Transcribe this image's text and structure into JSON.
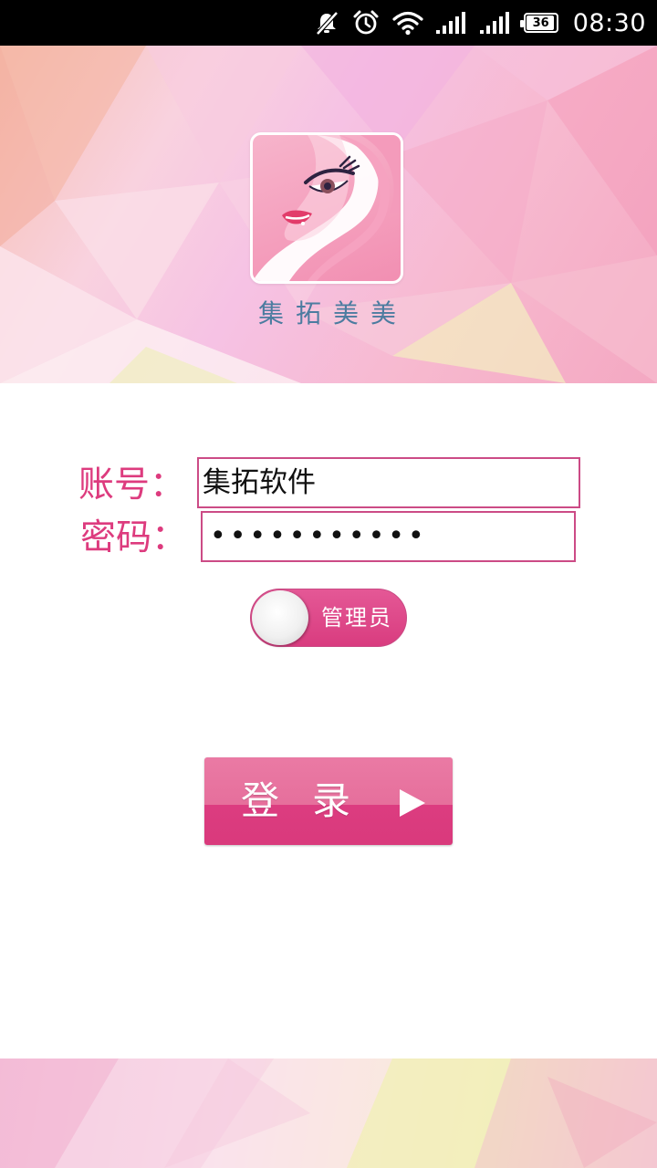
{
  "status_bar": {
    "time": "08:30",
    "battery_level": "36",
    "icons": [
      "notifications-off-icon",
      "alarm-icon",
      "wifi-icon",
      "signal-icon",
      "signal-icon",
      "battery-icon"
    ]
  },
  "banner": {
    "brand_name": "集拓美美"
  },
  "form": {
    "account_label": "账号：",
    "account_value": "集拓软件",
    "password_label": "密码：",
    "password_value": "•••••••••••"
  },
  "role_toggle": {
    "label": "管理员",
    "state": "on"
  },
  "login_button": {
    "label": "登录"
  },
  "colors": {
    "accent": "#dd3b7e",
    "brand_text": "#4c7ca0",
    "status_bar": "#000000"
  }
}
